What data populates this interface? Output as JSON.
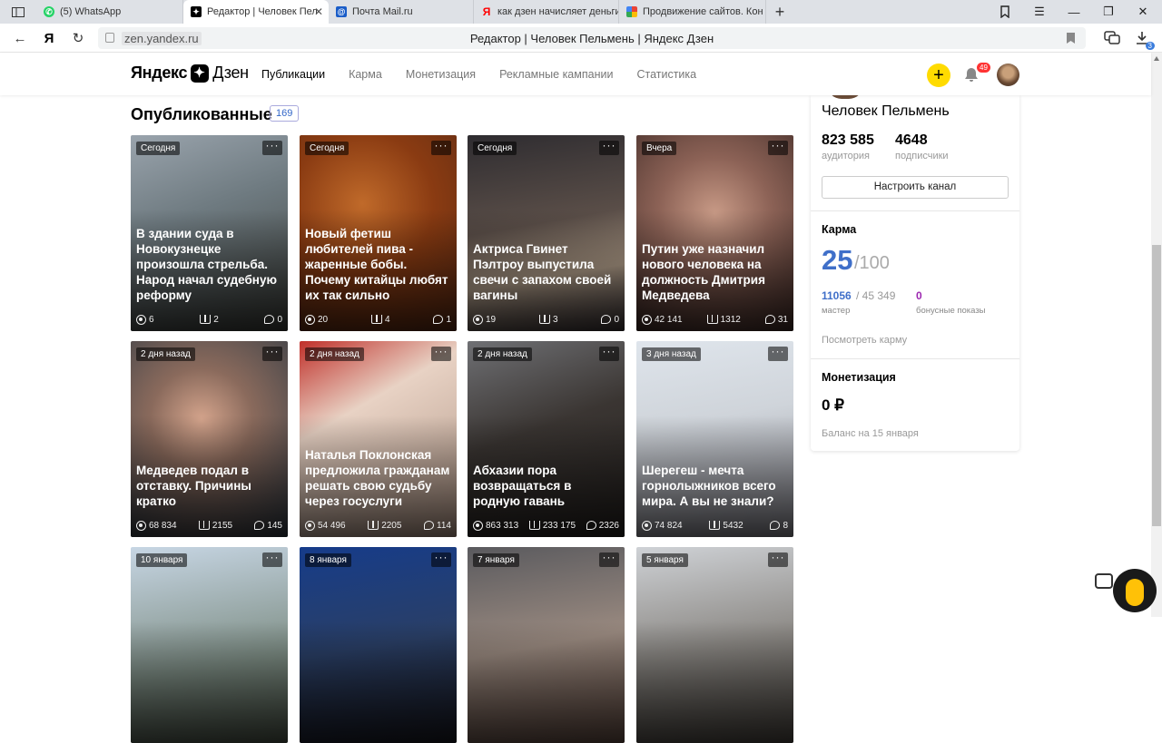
{
  "tabs": [
    {
      "title": "(5) WhatsApp",
      "icon": "whatsapp-icon",
      "color": "#25d366",
      "active": false
    },
    {
      "title": "Редактор | Человек Пел",
      "icon": "zen-icon",
      "color": "#000000",
      "active": true
    },
    {
      "title": "Почта Mail.ru",
      "icon": "mail-icon",
      "color": "#1a5dc8",
      "active": false
    },
    {
      "title": "как дзен начисляет деньги",
      "icon": "yandex-icon",
      "color": "#ff0000",
      "active": false
    },
    {
      "title": "Продвижение сайтов. Кон",
      "icon": "google-icon",
      "color": "#4285f4",
      "active": false
    }
  ],
  "address": {
    "host": "zen.yandex.ru",
    "page_title": "Редактор | Человек Пельмень | Яндекс Дзен",
    "downloads_badge": "3"
  },
  "header": {
    "logo_brand": "Яндекс",
    "logo_product": "Дзен",
    "nav": [
      "Публикации",
      "Карма",
      "Монетизация",
      "Рекламные кампании",
      "Статистика"
    ],
    "active_nav": "Публикации",
    "notifications": "49",
    "accent": "#ffdb00"
  },
  "section": {
    "title": "Опубликованные",
    "count": "169"
  },
  "cards": [
    {
      "date": "Сегодня",
      "title": "В здании суда в Новокузнецке произошла стрельба. Народ начал судебную реформу",
      "views": "6",
      "reads": "2",
      "comments": "0",
      "bg": "linear-gradient(160deg,#9aa4ad 0%,#6e7a80 40%,#3d3f3a 100%)"
    },
    {
      "date": "Сегодня",
      "title": "Новый фетиш любителей пива - жаренные бобы. Почему китайцы любят их так сильно",
      "views": "20",
      "reads": "4",
      "comments": "1",
      "bg": "radial-gradient(circle at 40% 35%,#c06a2a 0%,#8a3b12 45%,#5a2a14 100%)"
    },
    {
      "date": "Сегодня",
      "title": "Актриса Гвинет Пэлтроу выпустила свечи с запахом своей вагины",
      "views": "19",
      "reads": "3",
      "comments": "0",
      "bg": "linear-gradient(170deg,#2e2c30 0%,#5a4e48 45%,#b8a48f 70%,#3a3336 100%)"
    },
    {
      "date": "Вчера",
      "title": "Путин уже назначил нового человека на должность Дмитрия Медведева",
      "views": "42 141",
      "reads": "1312",
      "comments": "31",
      "bg": "radial-gradient(circle at 50% 40%,#c89a86 0%,#8c6256 40%,#3e2a26 100%)"
    },
    {
      "date": "2 дня назад",
      "title": "Медведев подал в отставку. Причины кратко",
      "views": "68 834",
      "reads": "2155",
      "comments": "145",
      "bg": "radial-gradient(circle at 45% 40%,#d4a48c 0%,#8a6a5c 35%,#2f3a44 100%)"
    },
    {
      "date": "2 дня назад",
      "title": "Наталья Поклонская предложила гражданам решать свою судьбу через госуслуги",
      "views": "54 496",
      "reads": "2205",
      "comments": "114",
      "bg": "linear-gradient(150deg,#c0302a 0%,#e8d2c4 35%,#c9b1a2 70%,#b59a8a 100%)"
    },
    {
      "date": "2 дня назад",
      "title": "Абхазии пора возвращаться в родную гавань",
      "views": "863 313",
      "reads": "233 175",
      "comments": "2326",
      "bg": "linear-gradient(160deg,#6f7074 0%,#3a3532 45%,#262220 100%)"
    },
    {
      "date": "3 дня назад",
      "title": "Шерегеш - мечта горнолыжников всего мира. А вы не знали?",
      "views": "74 824",
      "reads": "5432",
      "comments": "8",
      "bg": "linear-gradient(170deg,#dfe5ec 0%,#cfd4da 40%,#8b8a92 100%)"
    },
    {
      "date": "10 января",
      "title": "",
      "views": "",
      "reads": "",
      "comments": "",
      "bg": "linear-gradient(170deg,#c7d6e4 0%,#7f8f86 60%,#505a4c 100%)"
    },
    {
      "date": "8 января",
      "title": "",
      "views": "",
      "reads": "",
      "comments": "",
      "bg": "linear-gradient(170deg,#163c8a 0%,#2a3f66 50%,#1a1a22 100%)"
    },
    {
      "date": "7 января",
      "title": "",
      "views": "",
      "reads": "",
      "comments": "",
      "bg": "linear-gradient(170deg,#5a5a5e 0%,#9a8a80 50%,#6a5248 100%)"
    },
    {
      "date": "5 января",
      "title": "",
      "views": "",
      "reads": "",
      "comments": "",
      "bg": "linear-gradient(170deg,#cfd2d6 0%,#8d8a86 50%,#4f4a44 100%)"
    }
  ],
  "panel": {
    "name": "Человек Пельмень",
    "audience": "823 585",
    "audience_label": "аудитория",
    "subscribers": "4648",
    "subscribers_label": "подписчики",
    "setup_button": "Настроить канал",
    "karma_title": "Карма",
    "karma_value": "25",
    "karma_max": "/100",
    "master_value": "11056",
    "master_total": "/ 45 349",
    "master_label": "мастер",
    "bonus_value": "0",
    "bonus_label": "бонусные показы",
    "karma_link": "Посмотреть карму",
    "monetization_title": "Монетизация",
    "money": "0 ₽",
    "balance": "Баланс на 15 января",
    "karma_color": "#3f6fc9",
    "bonus_color": "#9c27b0"
  }
}
